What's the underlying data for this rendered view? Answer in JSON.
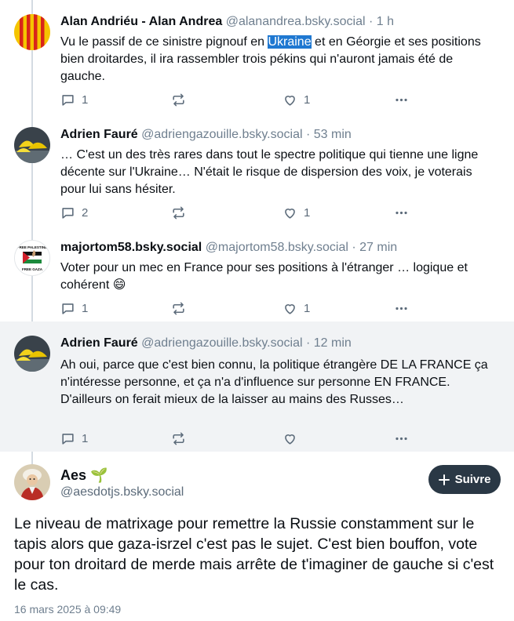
{
  "replies": [
    {
      "name": "Alan Andriéu - Alan Andrea",
      "handle": "@alanandrea.bsky.social",
      "time": "· 1 h",
      "text_before": "Vu le passif de ce sinistre pignouf en ",
      "text_highlight": "Ukraine",
      "text_after": " et en Géorgie et ses positions bien droitardes, il ira rassembler trois pékins qui n'auront jamais été de gauche.",
      "replies_count": "1",
      "likes_count": "1",
      "avatar": "catalan-flag"
    },
    {
      "name": "Adrien Fauré",
      "handle": "@adriengazouille.bsky.social",
      "time": "· 53 min",
      "text": "… C'est un des très rares dans tout le spectre politique qui tienne une ligne décente sur l'Ukraine… N'était le risque de dispersion des voix, je voterais pour lui sans hésiter.",
      "replies_count": "2",
      "likes_count": "1",
      "avatar": "yellow-umbrellas"
    },
    {
      "name": "majortom58.bsky.social",
      "handle": "@majortom58.bsky.social",
      "time": "· 27 min",
      "text": "Voter pour un mec en France pour ses positions à l'étranger … logique et cohérent 😄",
      "replies_count": "1",
      "likes_count": "1",
      "avatar": "free-palestine",
      "avatar_text_top": "FREE PALESTINE",
      "avatar_text_bottom": "FREE GAZA"
    },
    {
      "name": "Adrien Fauré",
      "handle": "@adriengazouille.bsky.social",
      "time": "· 12 min",
      "text": "Ah oui, parce que c'est bien connu, la politique étrangère DE LA FRANCE ça n'intéresse personne, et ça n'a d'influence sur personne EN FRANCE. D'ailleurs on ferait mieux de la laisser au mains des Russes…",
      "replies_count": "1",
      "likes_count": "",
      "avatar": "yellow-umbrellas"
    }
  ],
  "main_post": {
    "name": "Aes 🌱",
    "handle": "@aesdotjs.bsky.social",
    "follow_label": "Suivre",
    "text": "Le niveau de matrixage pour remettre la Russie constamment sur le tapis alors que gaza-isrzel c'est pas le sujet. C'est bien bouffon, vote pour ton droitard de merde mais arrête de t'imaginer de gauche si c'est le cas.",
    "date": "16 mars 2025 à 09:49",
    "avatar": "illustrated-character"
  },
  "colors": {
    "accent_button": "#2a3845",
    "highlight": "#1f78d1",
    "muted": "#6f7f8f"
  }
}
